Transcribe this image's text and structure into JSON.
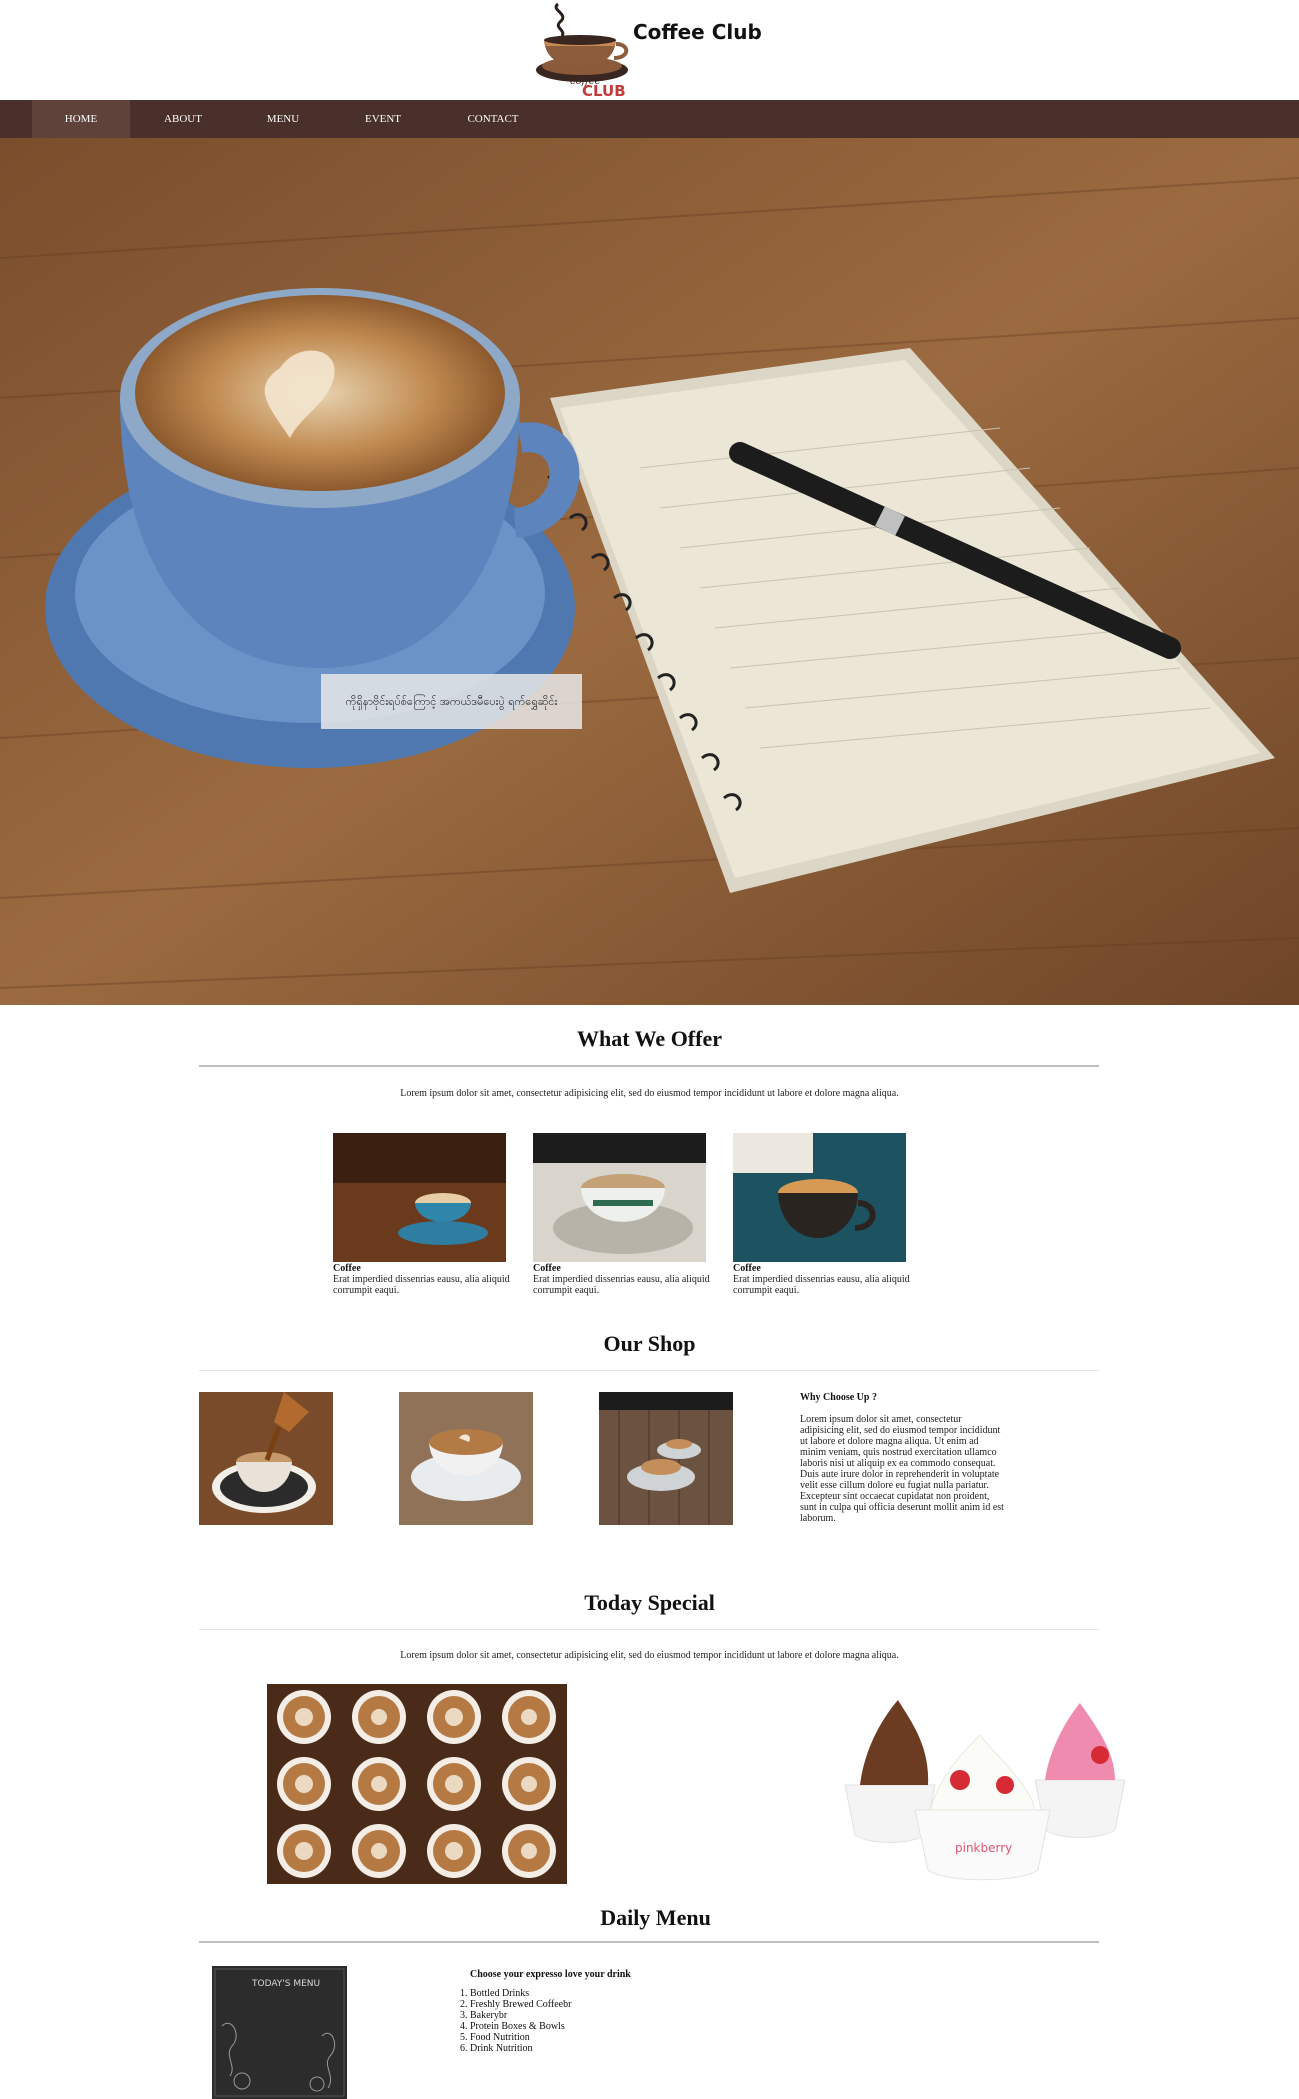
{
  "brand": {
    "name": "Coffee Club",
    "logo_text": "CLUB",
    "logo_script": "coffee"
  },
  "nav": {
    "items": [
      {
        "label": "HOME",
        "active": true
      },
      {
        "label": "ABOUT"
      },
      {
        "label": "MENU"
      },
      {
        "label": "EVENT"
      },
      {
        "label": "CONTACT"
      }
    ]
  },
  "hero": {
    "caption": "ကိုရှိနာဗိုင်းရပ်စ်ကြောင့် အကယ်ဒမီပေးပွဲ ရက်ရွှေဆိုင်း"
  },
  "offer": {
    "title": "What We Offer",
    "intro": "Lorem ipsum dolor sit amet, consectetur adipisicing elit, sed do eiusmod tempor incididunt ut labore et dolore magna aliqua.",
    "cards": [
      {
        "title": "Coffee",
        "text": "Erat imperdied dissenrias eausu, alia aliquid corrumpit eaqui."
      },
      {
        "title": "Coffee",
        "text": "Erat imperdied dissenrias eausu, alia aliquid corrumpit eaqui."
      },
      {
        "title": "Coffee",
        "text": "Erat imperdied dissenrias eausu, alia aliquid corrumpit eaqui."
      }
    ]
  },
  "shop": {
    "title": "Our Shop",
    "why_title": "Why Choose Up ?",
    "why_text": "Lorem ipsum dolor sit amet, consectetur adipisicing elit, sed do eiusmod tempor incididunt ut labore et dolore magna aliqua. Ut enim ad minim veniam, quis nostrud exercitation ullamco laboris nisi ut aliquip ex ea commodo consequat. Duis aute irure dolor in reprehenderit in voluptate velit esse cillum dolore eu fugiat nulla pariatur. Excepteur sint occaecat cupidatat non proident, sunt in culpa qui officia deserunt mollit anim id est laborum."
  },
  "special": {
    "title": "Today Special",
    "intro": "Lorem ipsum dolor sit amet, consectetur adipisicing elit, sed do eiusmod tempor incididunt ut labore et dolore magna aliqua.",
    "pinkberry_label": "pinkberry"
  },
  "daily_menu": {
    "title": "Daily Menu",
    "board_label": "TODAY'S MENU",
    "list_title": "Choose your expresso love your drink",
    "items": [
      "Bottled Drinks",
      "Freshly Brewed Coffeebr",
      "Bakerybr",
      "Protein Boxes & Bowls",
      "Food Nutrition",
      "Drink Nutrition"
    ]
  },
  "colors": {
    "nav_bg": "#4a302a",
    "nav_active": "#5f423a",
    "rule": "#bdbdbd"
  }
}
